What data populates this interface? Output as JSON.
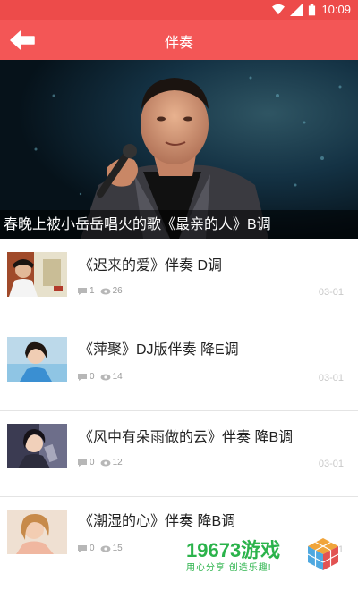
{
  "status_bar": {
    "time": "10:09",
    "icons": [
      "wifi-icon",
      "signal-icon",
      "battery-icon"
    ]
  },
  "app_bar": {
    "title": "伴奏",
    "back_icon": "arrow-left-icon"
  },
  "banner": {
    "caption": "春晚上被小岳岳唱火的歌《最亲的人》B调"
  },
  "list": [
    {
      "title": "《迟来的爱》伴奏 D调",
      "comments": "1",
      "views": "26",
      "date": "03-01"
    },
    {
      "title": "《萍聚》DJ版伴奏 降E调",
      "comments": "0",
      "views": "14",
      "date": "03-01"
    },
    {
      "title": "《风中有朵雨做的云》伴奏 降B调",
      "comments": "0",
      "views": "12",
      "date": "03-01"
    },
    {
      "title": "《潮湿的心》伴奏 降B调",
      "comments": "0",
      "views": "15",
      "date": "03-01"
    }
  ],
  "watermark": {
    "brand": "19673游戏",
    "slogan": "用心分享 创造乐趣!"
  },
  "colors": {
    "status_bar": "#ed4b4a",
    "app_bar": "#f35656",
    "watermark": "#2bb34b"
  }
}
